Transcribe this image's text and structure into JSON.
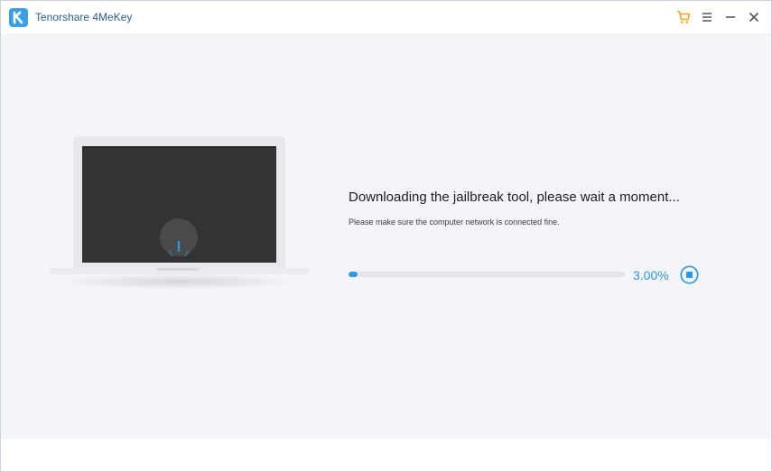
{
  "window": {
    "title": "Tenorshare 4MeKey",
    "logo_color": "#3a9ee8",
    "controls": [
      {
        "name": "cart-icon",
        "color": "#f0a71e"
      },
      {
        "name": "menu-icon",
        "color": "#555555"
      },
      {
        "name": "minimize-icon",
        "color": "#555555"
      },
      {
        "name": "close-icon",
        "color": "#555555"
      }
    ]
  },
  "main": {
    "heading": "Downloading the jailbreak tool, please wait a moment...",
    "subtext": "Please make sure the computer network is connected fine.",
    "progress": {
      "percent": 3.0,
      "label": "3.00%",
      "accent": "#2a98e3"
    },
    "stop_icon": "stop-circle-icon",
    "illustration": "laptop-download-icon"
  }
}
